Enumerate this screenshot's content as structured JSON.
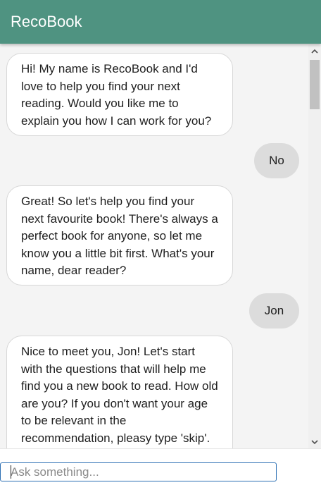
{
  "header": {
    "title": "RecoBook"
  },
  "colors": {
    "header": "#4f9381",
    "bot_bubble": "#ffffff",
    "user_bubble": "#dcdcdc",
    "input_border": "#2b6fb3"
  },
  "messages": [
    {
      "sender": "bot",
      "text": "Hi! My name is RecoBook and I'd love to help you find your next reading. Would you like me to explain you how I can work for you?"
    },
    {
      "sender": "user",
      "text": "No"
    },
    {
      "sender": "bot",
      "text": "Great! So let's help you find your next favourite book! There's always a perfect book for anyone, so let me know you a little bit first. What's your name, dear reader?"
    },
    {
      "sender": "user",
      "text": "Jon"
    },
    {
      "sender": "bot",
      "text": "Nice to meet you, Jon! Let's start with the questions that will help me find you a new book to read. How old are you? If you don't want your age to be relevant in the recommendation, pleasy type 'skip'."
    }
  ],
  "input": {
    "value": "",
    "placeholder": "Ask something..."
  },
  "icons": {
    "scroll_up": "chevron-up-icon",
    "scroll_down": "chevron-down-icon"
  }
}
